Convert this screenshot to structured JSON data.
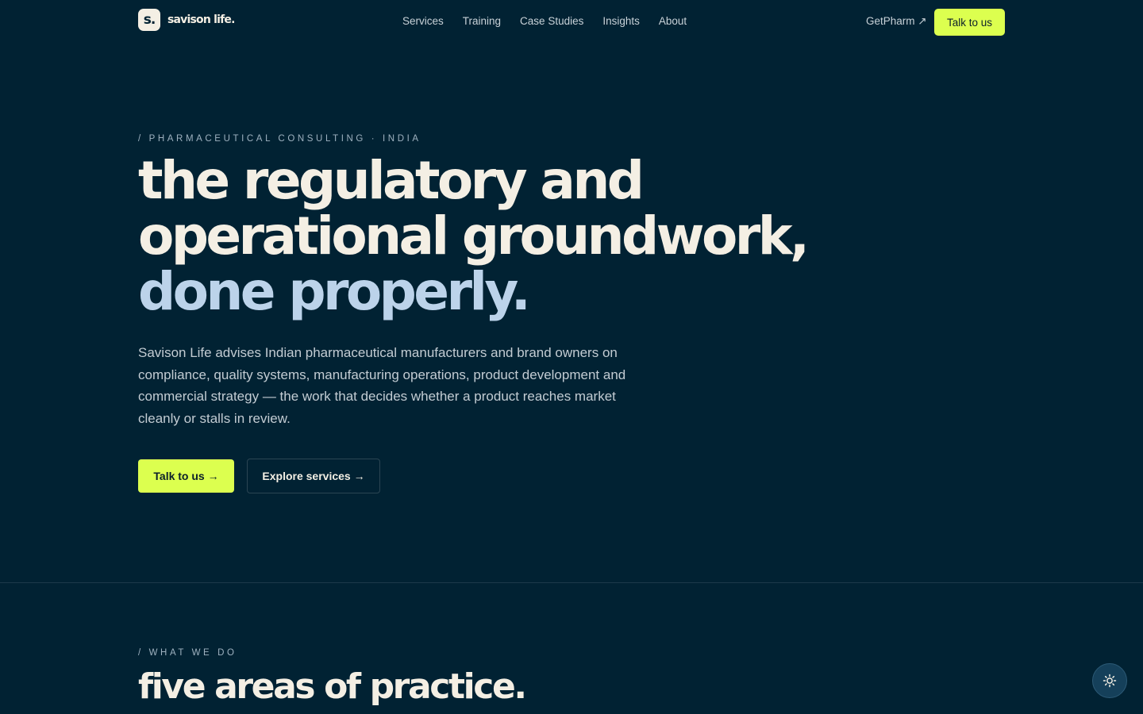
{
  "brand": {
    "mark": "s.",
    "name": "savison life."
  },
  "nav": {
    "items": [
      {
        "label": "Services"
      },
      {
        "label": "Training"
      },
      {
        "label": "Case Studies"
      },
      {
        "label": "Insights"
      },
      {
        "label": "About"
      }
    ],
    "external_link": "GetPharm ↗",
    "cta": "Talk to us"
  },
  "hero": {
    "eyebrow": "/ PHARMACEUTICAL CONSULTING · INDIA",
    "headline_line1": "the regulatory and",
    "headline_line2": "operational groundwork,",
    "headline_line3": "done properly.",
    "description": "Savison Life advises Indian pharmaceutical manufacturers and brand owners on compliance, quality systems, manufacturing operations, product development and commercial strategy — the work that decides whether a product reaches market cleanly or stalls in review.",
    "primary_cta": "Talk to us →",
    "secondary_cta": "Explore services →"
  },
  "what_we_do": {
    "eyebrow": "/ WHAT WE DO",
    "title": "five areas of practice."
  },
  "theme": {
    "icon": "sun-icon"
  },
  "colors": {
    "background": "#012233",
    "accent": "#dcff4f",
    "headline": "#f4efe4",
    "headline_accent": "#bcd3ea"
  }
}
